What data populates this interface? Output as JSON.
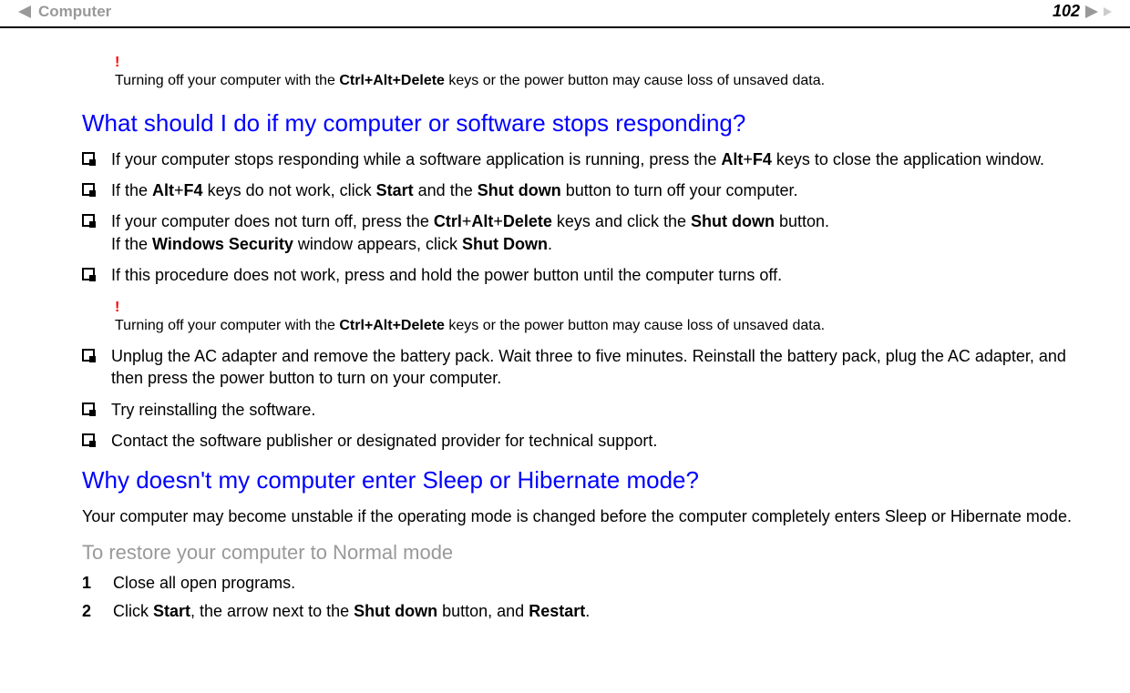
{
  "header": {
    "title": "Computer",
    "page_number": "102"
  },
  "warning_top": {
    "text_before": "Turning off your computer with the ",
    "bold_keys": "Ctrl+Alt+Delete",
    "text_after": " keys or the power button may cause loss of unsaved data."
  },
  "section1": {
    "heading": "What should I do if my computer or software stops responding?",
    "items": [
      {
        "pre": "If your computer stops responding while a software application is running, press the ",
        "b1": "Alt",
        "mid1": "+",
        "b2": "F4",
        "post": " keys to close the application window."
      },
      {
        "pre": "If the ",
        "b1": "Alt",
        "mid1": "+",
        "b2": "F4",
        "mid2": " keys do not work, click ",
        "b3": "Start",
        "mid3": " and the ",
        "b4": "Shut down",
        "post": " button to turn off your computer."
      },
      {
        "pre": "If your computer does not turn off, press the ",
        "b1": "Ctrl",
        "mid1": "+",
        "b2": "Alt",
        "mid2": "+",
        "b3": "Delete",
        "mid3": " keys and click the ",
        "b4": "Shut down",
        "mid4": " button.",
        "br": true,
        "pre2": "If the ",
        "b5": "Windows Security",
        "mid5": " window appears, click ",
        "b6": "Shut Down",
        "post": "."
      },
      {
        "pre": "If this procedure does not work, press and hold the power button until the computer turns off.",
        "plain": true
      }
    ],
    "warning_mid": {
      "text_before": "Turning off your computer with the ",
      "bold_keys": "Ctrl+Alt+Delete",
      "text_after": " keys or the power button may cause loss of unsaved data."
    },
    "items2": [
      {
        "text": "Unplug the AC adapter and remove the battery pack. Wait three to five minutes. Reinstall the battery pack, plug the AC adapter, and then press the power button to turn on your computer."
      },
      {
        "text": "Try reinstalling the software."
      },
      {
        "text": "Contact the software publisher or designated provider for technical support."
      }
    ]
  },
  "section2": {
    "heading": "Why doesn't my computer enter Sleep or Hibernate mode?",
    "paragraph": "Your computer may become unstable if the operating mode is changed before the computer completely enters Sleep or Hibernate mode.",
    "sub_heading": "To restore your computer to Normal mode",
    "steps": [
      {
        "num": "1",
        "text": "Close all open programs."
      },
      {
        "num": "2",
        "pre": "Click ",
        "b1": "Start",
        "mid1": ", the arrow next to the ",
        "b2": "Shut down",
        "mid2": " button, and ",
        "b3": "Restart",
        "post": "."
      }
    ]
  }
}
